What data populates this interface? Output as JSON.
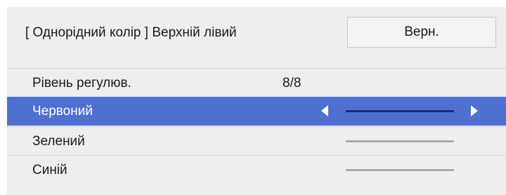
{
  "header": {
    "title": "[ Однорідний колір ] Верхній лівий",
    "return_label": "Верн."
  },
  "rows": [
    {
      "label": "Рівень регулюв.",
      "value": "8/8"
    },
    {
      "label": "Червоний",
      "selected": true,
      "slider_level": null
    },
    {
      "label": "Зелений",
      "slider_level": null
    },
    {
      "label": "Синій",
      "slider_level": null
    }
  ],
  "icons": {
    "left_arrow": "triangle-left-icon",
    "right_arrow": "triangle-right-icon"
  },
  "colors": {
    "panel_background": "#eeeeee",
    "selection_highlight": "#4f6fd1",
    "slider_track": "#aaaaaa",
    "slider_track_selected": "#1c2c6a",
    "text": "#1a1a1a"
  }
}
